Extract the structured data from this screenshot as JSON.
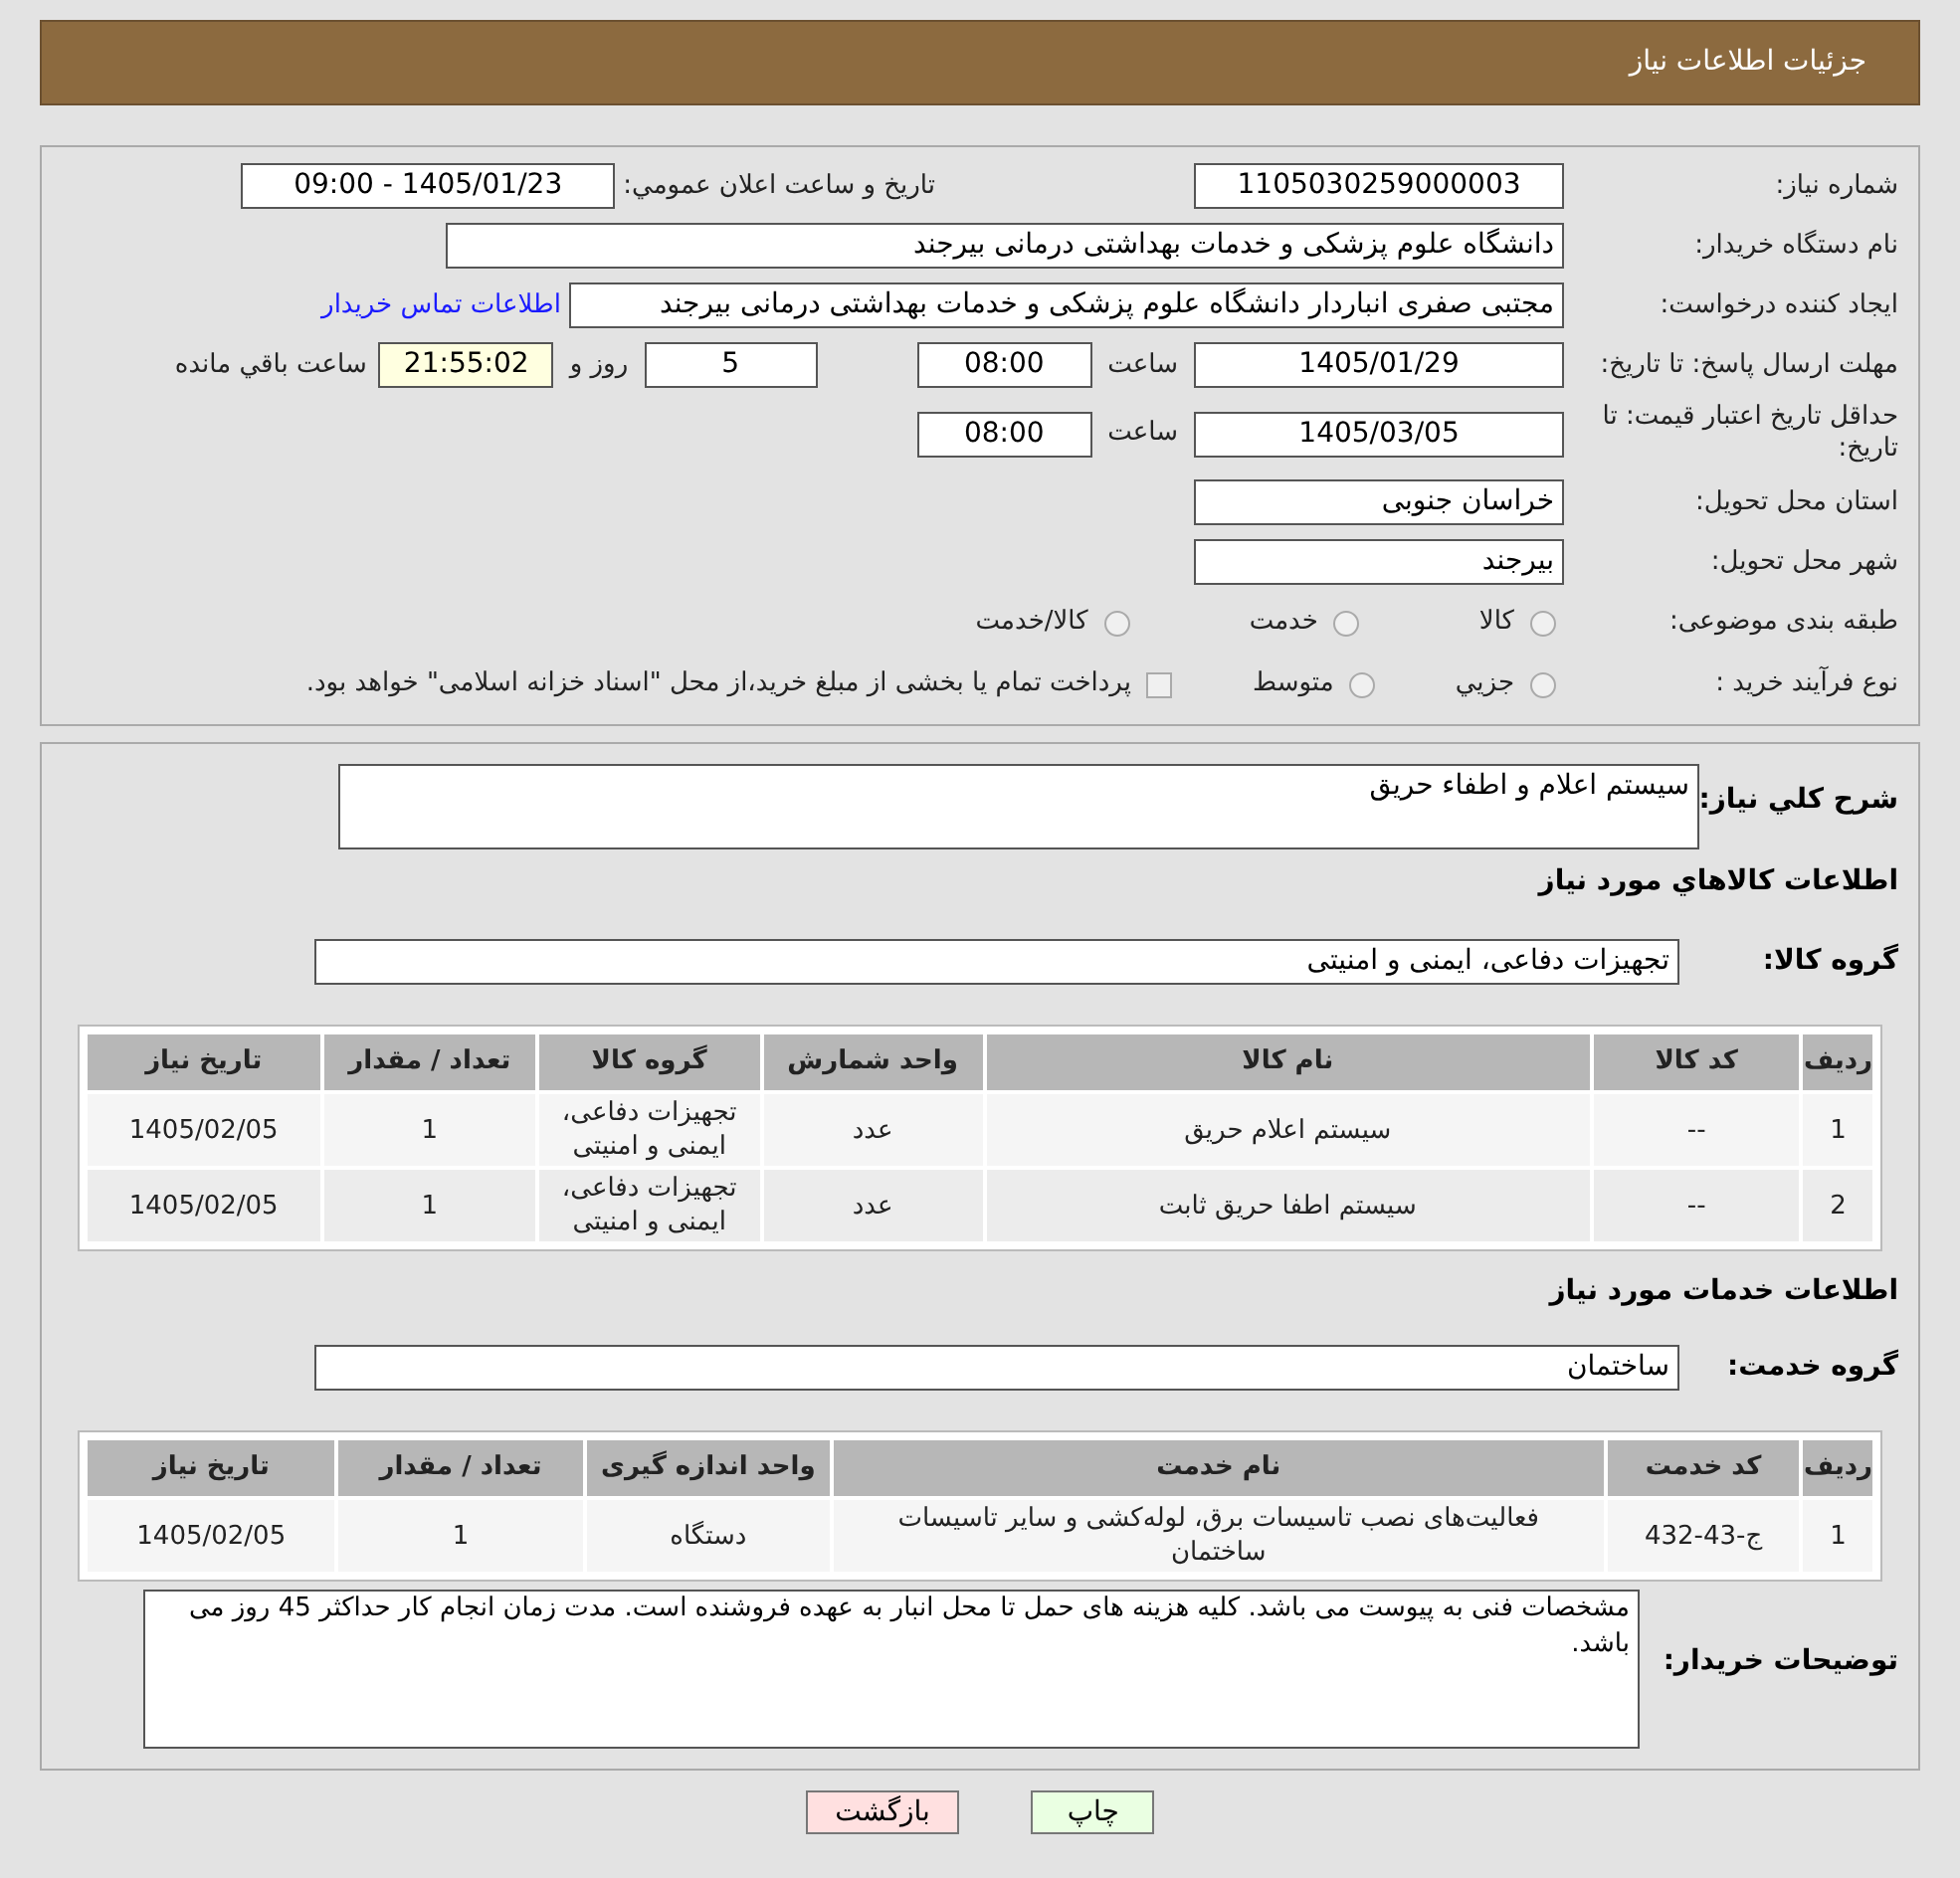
{
  "header": {
    "title": "جزئیات اطلاعات نیاز"
  },
  "need_number": {
    "label": "شماره نیاز:",
    "value": "1105030259000003"
  },
  "announce": {
    "label": "تاریخ و ساعت اعلان عمومي:",
    "value": "1405/01/23 - 09:00"
  },
  "buyer": {
    "label": "نام دستگاه خریدار:",
    "value": "دانشگاه علوم پزشکی و خدمات بهداشتی درمانی بیرجند"
  },
  "requester": {
    "label": "ایجاد کننده درخواست:",
    "value": "مجتبی صفری انباردار دانشگاه علوم پزشکی و خدمات بهداشتی درمانی بیرجند",
    "link": "اطلاعات تماس خریدار"
  },
  "deadline": {
    "label": "مهلت ارسال پاسخ: تا تاریخ:",
    "date": "1405/01/29",
    "time_label": "ساعت",
    "time": "08:00",
    "days": "5",
    "days_label": "روز و",
    "remaining": "21:55:02",
    "remaining_label": "ساعت باقي مانده"
  },
  "validity": {
    "label": "حداقل تاریخ اعتبار قیمت: تا تاریخ:",
    "date": "1405/03/05",
    "time_label": "ساعت",
    "time": "08:00"
  },
  "province": {
    "label": "استان محل تحویل:",
    "value": "خراسان جنوبی"
  },
  "city": {
    "label": "شهر محل تحویل:",
    "value": "بیرجند"
  },
  "category": {
    "label": "طبقه بندی موضوعی:",
    "options": [
      {
        "label": "کالا",
        "selected": false
      },
      {
        "label": "خدمت",
        "selected": false
      },
      {
        "label": "کالا/خدمت",
        "selected": false
      }
    ]
  },
  "process": {
    "label": "نوع فرآیند خرید :",
    "options": [
      {
        "label": "جزيي",
        "selected": false
      },
      {
        "label": "متوسط",
        "selected": false
      }
    ],
    "payment": {
      "label": "پرداخت تمام یا بخشی از مبلغ خرید،از محل \"اسناد خزانه اسلامی\" خواهد بود.",
      "checked": false
    }
  },
  "description": {
    "label": "شرح کلي نیاز:",
    "value": "سیستم اعلام و اطفاء حریق"
  },
  "goods": {
    "title": "اطلاعات کالاهاي مورد نیاز",
    "group_label": "گروه کالا:",
    "group": "تجهیزات دفاعی، ایمنی و امنیتی",
    "columns": [
      "ردیف",
      "کد کالا",
      "نام کالا",
      "واحد شمارش",
      "گروه کالا",
      "تعداد / مقدار",
      "تاریخ نیاز"
    ],
    "rows": [
      [
        "1",
        "--",
        "سیستم اعلام حریق",
        "عدد",
        "تجهیزات دفاعی، ایمنی و امنیتی",
        "1",
        "1405/02/05"
      ],
      [
        "2",
        "--",
        "سیستم اطفا حریق ثابت",
        "عدد",
        "تجهیزات دفاعی، ایمنی و امنیتی",
        "1",
        "1405/02/05"
      ]
    ]
  },
  "services": {
    "title": "اطلاعات خدمات مورد نیاز",
    "group_label": "گروه خدمت:",
    "group": "ساختمان",
    "columns": [
      "ردیف",
      "کد خدمت",
      "نام خدمت",
      "واحد اندازه گیری",
      "تعداد / مقدار",
      "تاریخ نیاز"
    ],
    "rows": [
      [
        "1",
        "ج-43-432",
        "فعالیت‌های نصب تاسیسات برق، لوله‌کشی و سایر تاسیسات ساختمان",
        "دستگاه",
        "1",
        "1405/02/05"
      ]
    ]
  },
  "notes": {
    "label": "توضیحات خریدار:",
    "value": "مشخصات فنی به پیوست می باشد. کلیه هزینه های حمل تا محل انبار به عهده فروشنده است. مدت زمان انجام کار حداکثر 45 روز می باشد."
  },
  "buttons": [
    {
      "kind": "print",
      "label": "چاپ"
    },
    {
      "kind": "back",
      "label": "بازگشت"
    }
  ]
}
